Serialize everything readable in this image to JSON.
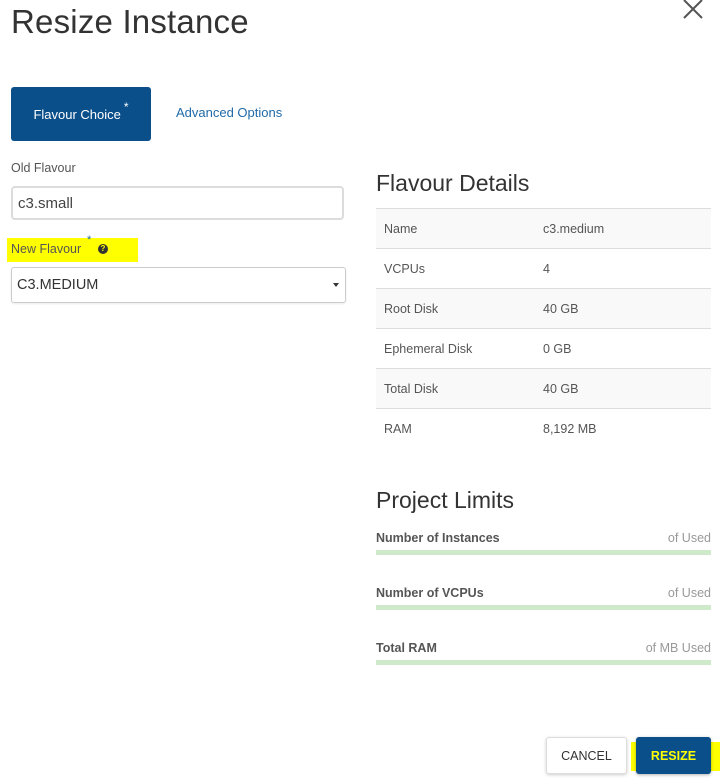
{
  "dialog": {
    "title": "Resize Instance",
    "close_icon": "close-icon"
  },
  "tabs": [
    {
      "label": "Flavour Choice",
      "required_marker": "*",
      "active": true
    },
    {
      "label": "Advanced Options",
      "active": false
    }
  ],
  "form": {
    "old_flavour": {
      "label": "Old Flavour",
      "value": "c3.small"
    },
    "new_flavour": {
      "label": "New Flavour",
      "required_marker": "*",
      "help_icon": "question-circle-icon",
      "help_glyph": "?",
      "selected": "C3.MEDIUM"
    }
  },
  "flavour_details": {
    "heading": "Flavour Details",
    "rows": [
      {
        "name": "Name",
        "value": "c3.medium"
      },
      {
        "name": "VCPUs",
        "value": "4"
      },
      {
        "name": "Root Disk",
        "value": "40 GB"
      },
      {
        "name": "Ephemeral Disk",
        "value": "0 GB"
      },
      {
        "name": "Total Disk",
        "value": "40 GB"
      },
      {
        "name": "RAM",
        "value": "8,192 MB"
      }
    ]
  },
  "project_limits": {
    "heading": "Project Limits",
    "items": [
      {
        "name": "Number of Instances",
        "used_text": "of Used",
        "fraction": 0
      },
      {
        "name": "Number of VCPUs",
        "used_text": "of Used",
        "fraction": 0
      },
      {
        "name": "Total RAM",
        "used_text": "of MB Used",
        "fraction": 0
      }
    ]
  },
  "footer": {
    "cancel_label": "CANCEL",
    "resize_label": "RESIZE"
  },
  "colors": {
    "primary": "#0b4f8a",
    "link": "#1f6aa8",
    "highlight": "#ffff00",
    "limit_bar": "#cfe9cb"
  }
}
